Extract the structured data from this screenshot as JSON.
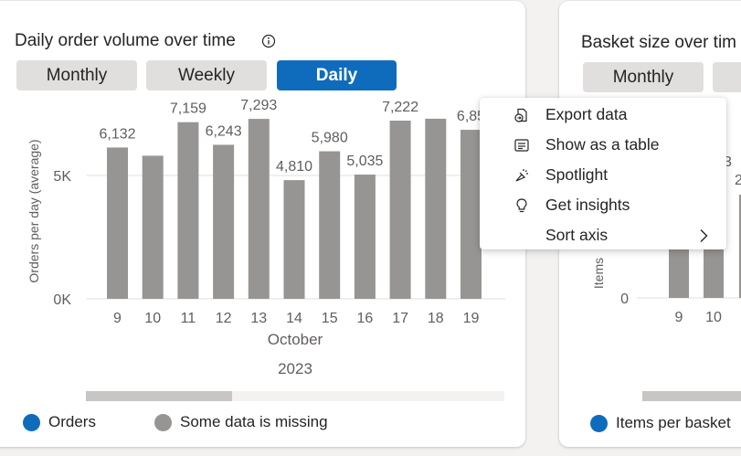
{
  "left_card": {
    "title": "Daily order volume over time",
    "info_icon": "info-circle-icon",
    "toggles": [
      {
        "label": "Monthly",
        "active": false
      },
      {
        "label": "Weekly",
        "active": false
      },
      {
        "label": "Daily",
        "active": true
      }
    ],
    "legend": [
      {
        "label": "Orders",
        "color": "#0f6cbd"
      },
      {
        "label": "Some data is missing",
        "color": "#979593"
      }
    ],
    "scrollbar_position": 0.3
  },
  "right_card": {
    "title": "Basket size over tim",
    "toggles": [
      {
        "label": "Monthly",
        "active": false
      }
    ],
    "y_axis_title": "Items",
    "y_tick_label": "0",
    "x_tick_labels": [
      "9",
      "10"
    ],
    "partial_labels": [
      "3",
      "2"
    ],
    "legend": [
      {
        "label": "Items per basket",
        "color": "#0f6cbd"
      }
    ]
  },
  "context_menu": {
    "items": [
      {
        "label": "Export data",
        "icon": "export-icon"
      },
      {
        "label": "Show as a table",
        "icon": "table-icon"
      },
      {
        "label": "Spotlight",
        "icon": "spotlight-icon"
      },
      {
        "label": "Get insights",
        "icon": "lightbulb-icon"
      },
      {
        "label": "Sort axis",
        "icon": "chevron-right-icon"
      }
    ]
  },
  "colors": {
    "accent": "#0f6cbd",
    "bar": "#979593",
    "toggle_bg": "#e1dfdd"
  },
  "chart_data": {
    "type": "bar",
    "categories": [
      "9",
      "10",
      "11",
      "12",
      "13",
      "14",
      "15",
      "16",
      "17",
      "18",
      "19"
    ],
    "series": [
      {
        "name": "Some data is missing",
        "values": [
          6132,
          5800,
          7159,
          6243,
          7293,
          4810,
          5980,
          5035,
          7222,
          7300,
          6850
        ]
      }
    ],
    "data_labels": [
      "6,132",
      "",
      "7,159",
      "6,243",
      "7,293",
      "4,810",
      "5,980",
      "5,035",
      "7,222",
      "",
      "6,85"
    ],
    "xlabel_group": "October",
    "xlabel_year": "2023",
    "ylabel": "Orders per day (average)",
    "yticks": [
      {
        "value": 0,
        "label": "0K"
      },
      {
        "value": 5000,
        "label": "5K"
      }
    ],
    "ylim": [
      0,
      8000
    ],
    "grid": true
  }
}
